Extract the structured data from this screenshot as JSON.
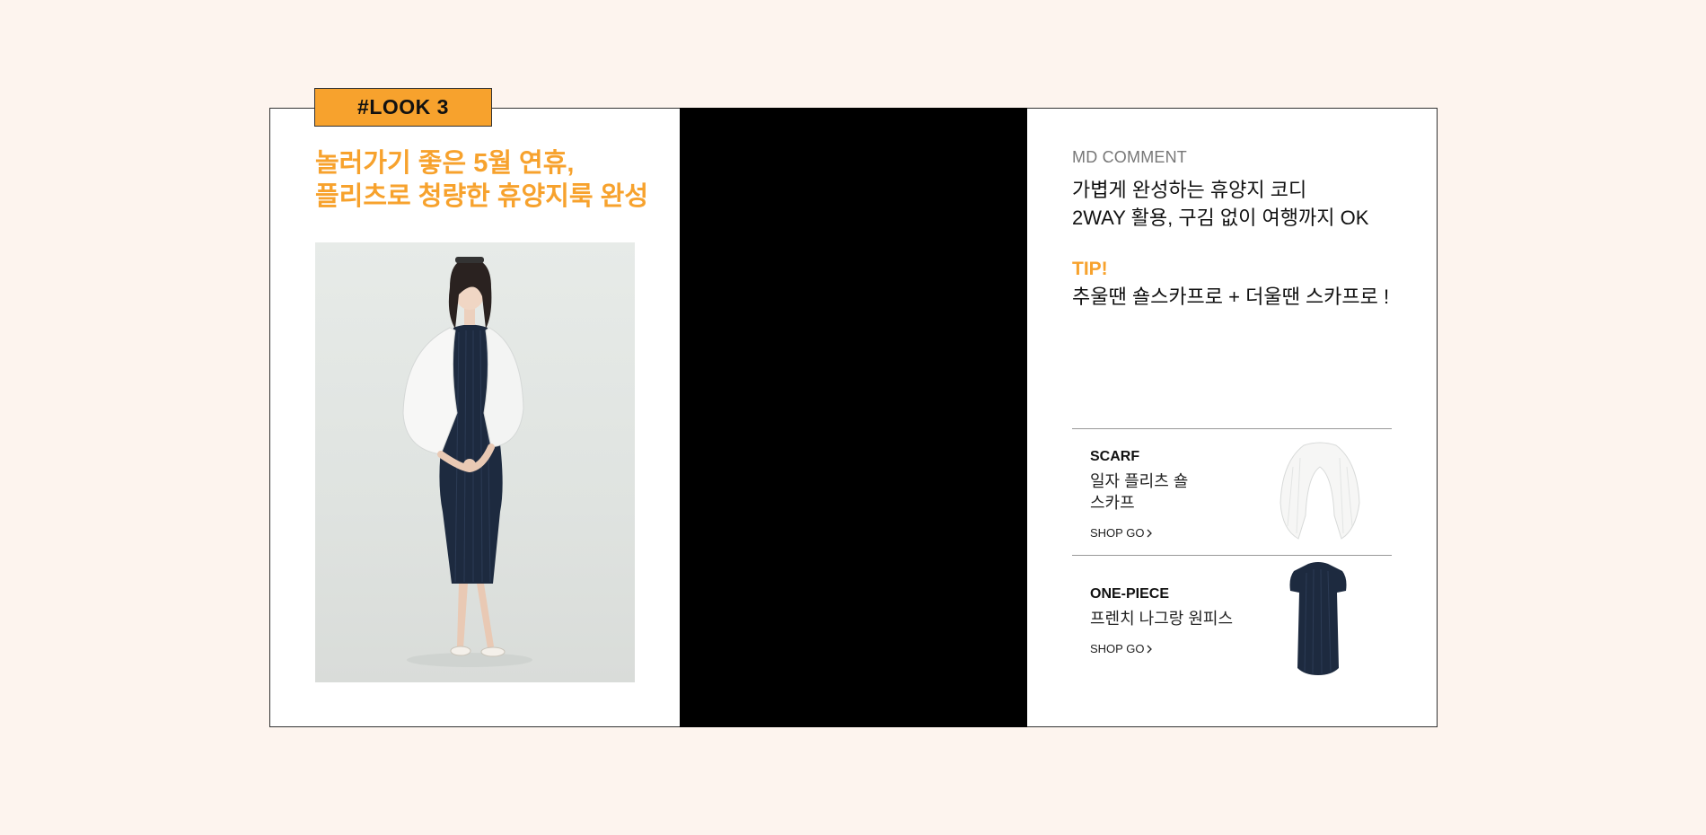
{
  "look": {
    "tag": "#LOOK 3"
  },
  "left": {
    "title_line1": "놀러가기 좋은 5월 연휴,",
    "title_line2": "플리츠로 청량한 휴양지룩 완성"
  },
  "md": {
    "label": "MD COMMENT",
    "comment_line1": "가볍게 완성하는 휴양지 코디",
    "comment_line2": "2WAY 활용, 구김 없이 여행까지 OK",
    "tip_label": "TIP!",
    "tip_text": "추울땐 숄스카프로 + 더울땐 스카프로 !"
  },
  "products": [
    {
      "category": "SCARF",
      "name_line1": "일자 플리츠 숄",
      "name_line2": "스카프",
      "shop_label": "SHOP GO",
      "icon": "chevron-right-icon"
    },
    {
      "category": "ONE-PIECE",
      "name_line1": "프렌치 나그랑 원피스",
      "shop_label": "SHOP GO",
      "icon": "chevron-right-icon"
    }
  ],
  "colors": {
    "accent": "#f7a22d",
    "background": "#fdf4ee",
    "dress": "#1d2a3f"
  }
}
